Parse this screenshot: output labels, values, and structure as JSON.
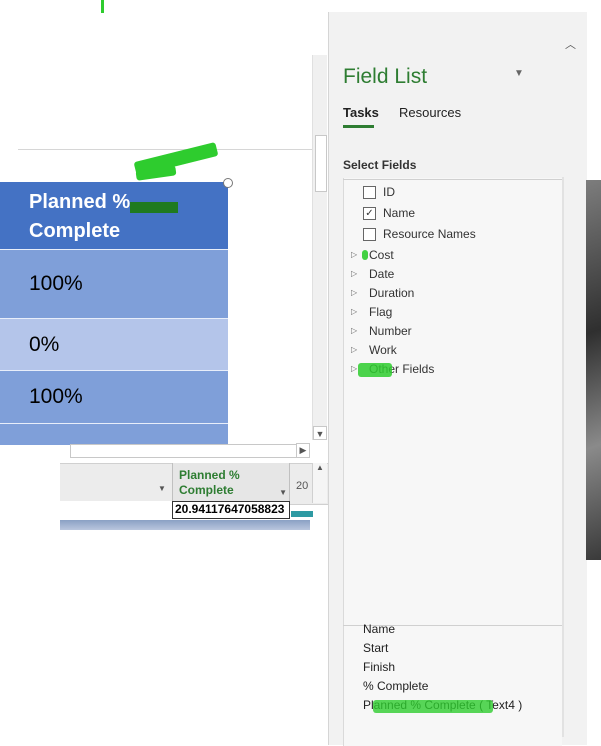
{
  "report": {
    "header_line1": "Planned  %",
    "header_line2": "Complete",
    "rows": [
      "100%",
      "0%",
      "100%"
    ]
  },
  "grid": {
    "column_header_line1": "Planned  %",
    "column_header_line2": "Complete",
    "cell_value": "20.94117647058823",
    "timescale_label": "20"
  },
  "field_list": {
    "title": "Field List",
    "tabs": [
      "Tasks",
      "Resources"
    ],
    "active_tab": "Tasks",
    "section_label": "Select Fields",
    "fields": [
      {
        "label": "ID",
        "type": "checkbox",
        "checked": false
      },
      {
        "label": "Name",
        "type": "checkbox",
        "checked": true
      },
      {
        "label": "Resource Names",
        "type": "checkbox",
        "checked": false
      },
      {
        "label": "Cost",
        "type": "group"
      },
      {
        "label": "Date",
        "type": "group"
      },
      {
        "label": "Duration",
        "type": "group"
      },
      {
        "label": "Flag",
        "type": "group"
      },
      {
        "label": "Number",
        "type": "group"
      },
      {
        "label": "Work",
        "type": "group"
      },
      {
        "label": "Other Fields",
        "type": "group"
      }
    ],
    "selected_fields": [
      "Name",
      "Start",
      "Finish",
      "% Complete",
      "Planned  % Complete ( Text4 )"
    ]
  },
  "colors": {
    "accent_green": "#2e7d32",
    "highlight_green": "#2ecc2e",
    "table_header_blue": "#4472c4",
    "table_row_blue": "#7f9fd9",
    "table_row_light": "#b4c5ea"
  }
}
